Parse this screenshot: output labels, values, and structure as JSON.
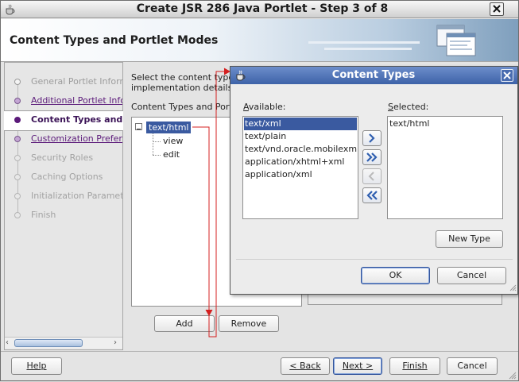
{
  "window": {
    "title": "Create JSR 286 Java Portlet - Step 3 of 8"
  },
  "header": {
    "title": "Content Types and Portlet Modes"
  },
  "nav": {
    "items": [
      {
        "label": "General Portlet Information",
        "state": "done"
      },
      {
        "label": "Additional Portlet Information",
        "state": "link"
      },
      {
        "label": "Content Types and Portlet Modes",
        "state": "current"
      },
      {
        "label": "Customization Preferences",
        "state": "link"
      },
      {
        "label": "Security Roles",
        "state": "disabled"
      },
      {
        "label": "Caching Options",
        "state": "disabled"
      },
      {
        "label": "Initialization Parameters",
        "state": "disabled"
      },
      {
        "label": "Finish",
        "state": "disabled"
      }
    ]
  },
  "main": {
    "intro_line1": "Select the content types",
    "intro_line2": "implementation details f",
    "tree_label": "Content Types and Portl",
    "tree": {
      "root": "text/html",
      "children": [
        "view",
        "edit"
      ]
    },
    "add_label": "Add",
    "remove_label": "Remove"
  },
  "footer": {
    "help": "Help",
    "back": "< Back",
    "next": "Next >",
    "finish": "Finish",
    "cancel": "Cancel"
  },
  "dialog": {
    "title": "Content Types",
    "available_label": "Available:",
    "selected_label": "Selected:",
    "available": [
      "text/xml",
      "text/plain",
      "text/vnd.oracle.mobilexml",
      "application/xhtml+xml",
      "application/xml"
    ],
    "selected": [
      "text/html"
    ],
    "new_type": "New Type",
    "ok": "OK",
    "cancel": "Cancel"
  },
  "colors": {
    "accent": "#3a5aa0",
    "link": "#5b1a7a",
    "annotation": "#d42020"
  }
}
